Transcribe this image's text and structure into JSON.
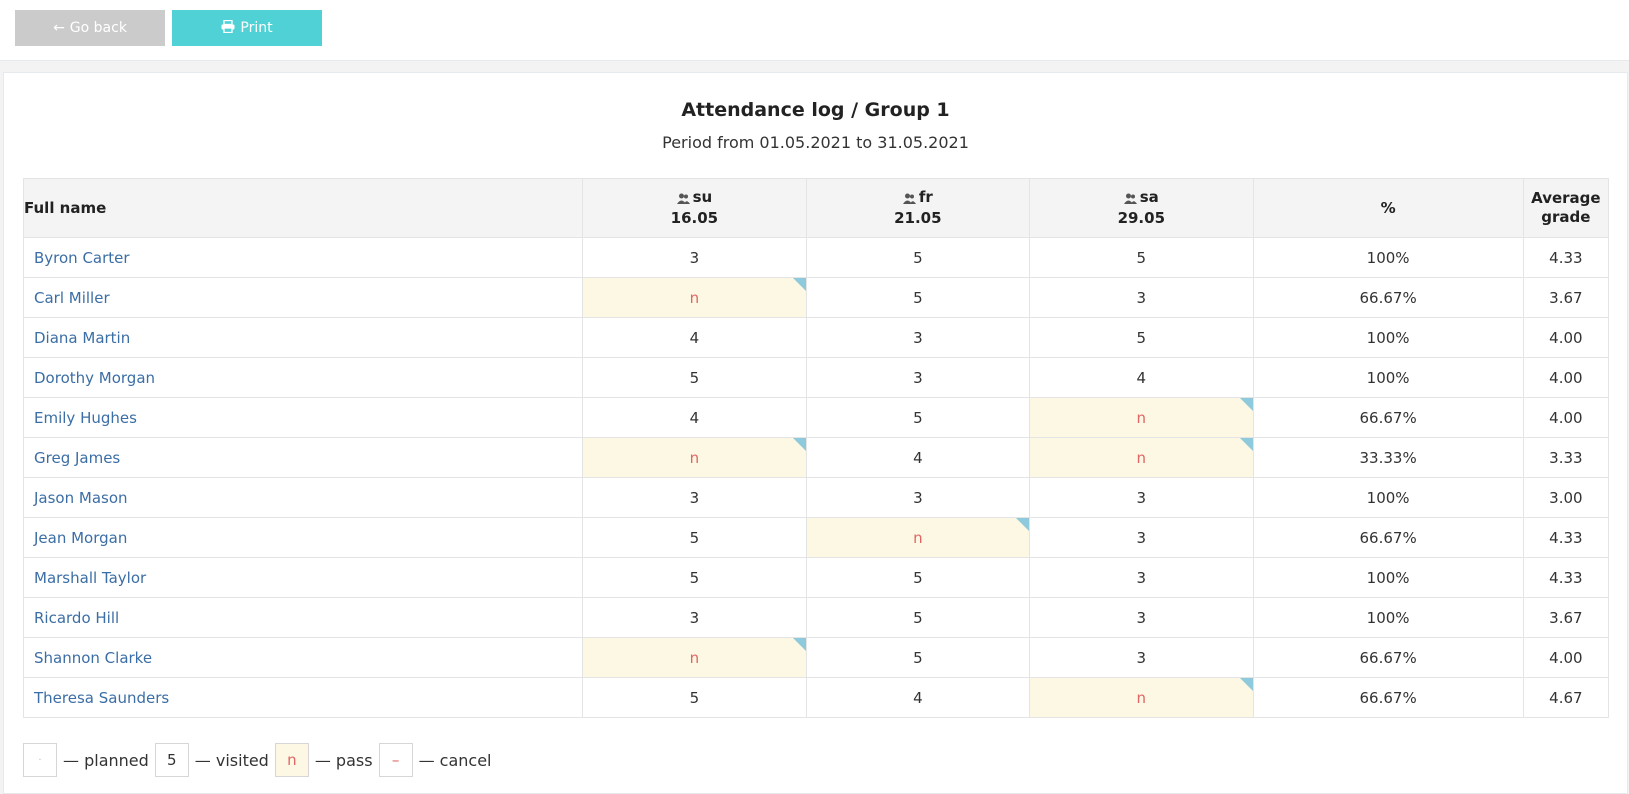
{
  "toolbar": {
    "back_label": "Go back",
    "back_icon": "arrow-left-icon",
    "print_label": "Print",
    "print_icon": "printer-icon"
  },
  "report": {
    "title": "Attendance log / Group 1",
    "period": "Period from 01.05.2021 to 31.05.2021"
  },
  "table": {
    "headers": {
      "name": "Full name",
      "days": [
        {
          "weekday": "su",
          "date": "16.05"
        },
        {
          "weekday": "fr",
          "date": "21.05"
        },
        {
          "weekday": "sa",
          "date": "29.05"
        }
      ],
      "percent": "%",
      "average_line1": "Average",
      "average_line2": "grade"
    },
    "rows": [
      {
        "name": "Byron Carter",
        "marks": [
          "3",
          "5",
          "5"
        ],
        "percent": "100%",
        "avg": "4.33"
      },
      {
        "name": "Carl Miller",
        "marks": [
          "n",
          "5",
          "3"
        ],
        "percent": "66.67%",
        "avg": "3.67"
      },
      {
        "name": "Diana Martin",
        "marks": [
          "4",
          "3",
          "5"
        ],
        "percent": "100%",
        "avg": "4.00"
      },
      {
        "name": "Dorothy Morgan",
        "marks": [
          "5",
          "3",
          "4"
        ],
        "percent": "100%",
        "avg": "4.00"
      },
      {
        "name": "Emily Hughes",
        "marks": [
          "4",
          "5",
          "n"
        ],
        "percent": "66.67%",
        "avg": "4.00"
      },
      {
        "name": "Greg James",
        "marks": [
          "n",
          "4",
          "n"
        ],
        "percent": "33.33%",
        "avg": "3.33"
      },
      {
        "name": "Jason Mason",
        "marks": [
          "3",
          "3",
          "3"
        ],
        "percent": "100%",
        "avg": "3.00"
      },
      {
        "name": "Jean Morgan",
        "marks": [
          "5",
          "n",
          "3"
        ],
        "percent": "66.67%",
        "avg": "4.33"
      },
      {
        "name": "Marshall Taylor",
        "marks": [
          "5",
          "5",
          "3"
        ],
        "percent": "100%",
        "avg": "4.33"
      },
      {
        "name": "Ricardo Hill",
        "marks": [
          "3",
          "5",
          "3"
        ],
        "percent": "100%",
        "avg": "3.67"
      },
      {
        "name": "Shannon Clarke",
        "marks": [
          "n",
          "5",
          "3"
        ],
        "percent": "66.67%",
        "avg": "4.00"
      },
      {
        "name": "Theresa Saunders",
        "marks": [
          "5",
          "4",
          "n"
        ],
        "percent": "66.67%",
        "avg": "4.67"
      }
    ]
  },
  "legend": {
    "planned_symbol": "·",
    "planned_label": "— planned",
    "visited_symbol": "5",
    "visited_label": "— visited",
    "pass_symbol": "n",
    "pass_label": "— pass",
    "cancel_symbol": "–",
    "cancel_label": "— cancel"
  },
  "colors": {
    "print_button": "#4fd1d6",
    "back_button": "#cbcbcb",
    "pass_cell": "#fcf8e3",
    "pass_text": "#e06666",
    "name_link": "#3b6ea5",
    "pass_corner": "#8ec9dc"
  }
}
